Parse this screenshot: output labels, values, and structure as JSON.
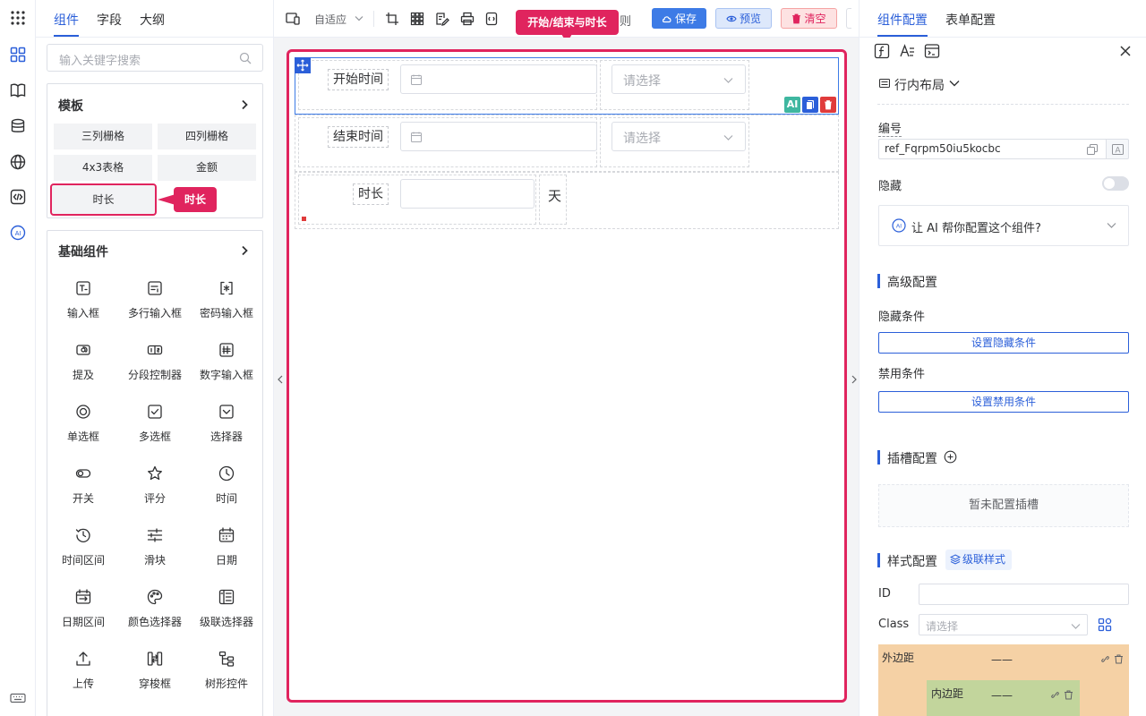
{
  "left_rail": {
    "icons": [
      "apps-grid-icon",
      "widgets-icon",
      "book-icon",
      "database-icon",
      "globe-icon",
      "code-icon",
      "ai-icon",
      "keyboard-icon"
    ]
  },
  "left_panel": {
    "tabs": [
      {
        "label": "组件",
        "active": true
      },
      {
        "label": "字段",
        "active": false
      },
      {
        "label": "大纲",
        "active": false
      }
    ],
    "search_placeholder": "输入关键字搜索",
    "templates": {
      "title": "模板",
      "items": [
        "三列栅格",
        "四列栅格",
        "4x3表格",
        "金额",
        "时长"
      ],
      "highlighted": "时长"
    },
    "basic": {
      "title": "基础组件",
      "items": [
        {
          "label": "输入框",
          "icon": "text-input-icon"
        },
        {
          "label": "多行输入框",
          "icon": "textarea-icon"
        },
        {
          "label": "密码输入框",
          "icon": "password-icon"
        },
        {
          "label": "提及",
          "icon": "mention-icon"
        },
        {
          "label": "分段控制器",
          "icon": "segmented-icon"
        },
        {
          "label": "数字输入框",
          "icon": "number-input-icon"
        },
        {
          "label": "单选框",
          "icon": "radio-icon"
        },
        {
          "label": "多选框",
          "icon": "checkbox-icon"
        },
        {
          "label": "选择器",
          "icon": "select-icon"
        },
        {
          "label": "开关",
          "icon": "switch-icon"
        },
        {
          "label": "评分",
          "icon": "star-icon"
        },
        {
          "label": "时间",
          "icon": "clock-icon"
        },
        {
          "label": "时间区间",
          "icon": "time-range-icon"
        },
        {
          "label": "滑块",
          "icon": "slider-icon"
        },
        {
          "label": "日期",
          "icon": "calendar-icon"
        },
        {
          "label": "日期区间",
          "icon": "date-range-icon"
        },
        {
          "label": "颜色选择器",
          "icon": "palette-icon"
        },
        {
          "label": "级联选择器",
          "icon": "cascader-icon"
        },
        {
          "label": "上传",
          "icon": "upload-icon"
        },
        {
          "label": "穿梭框",
          "icon": "transfer-icon"
        },
        {
          "label": "树形控件",
          "icon": "tree-icon"
        }
      ]
    }
  },
  "tooltips": {
    "duration": "时长",
    "canvas": "开始/结束与时长"
  },
  "toolbar": {
    "layout_mode": "自适应",
    "partial_text": "则",
    "save": "保存",
    "preview": "预览",
    "clear": "清空"
  },
  "canvas": {
    "rows": [
      {
        "label": "开始时间",
        "select_placeholder": "请选择"
      },
      {
        "label": "结束时间",
        "select_placeholder": "请选择"
      },
      {
        "label": "时长",
        "suffix": "天"
      }
    ]
  },
  "right_panel": {
    "tabs": [
      {
        "label": "组件配置",
        "active": true
      },
      {
        "label": "表单配置",
        "active": false
      }
    ],
    "component_type": "行内布局",
    "id_label": "编号",
    "id_value": "ref_Fqrpm50iu5kocbc",
    "hidden_label": "隐藏",
    "hidden_on": false,
    "ai_prompt": "让 AI 帮你配置这个组件?",
    "advanced_title": "高级配置",
    "hide_cond_label": "隐藏条件",
    "hide_cond_btn": "设置隐藏条件",
    "disable_cond_label": "禁用条件",
    "disable_cond_btn": "设置禁用条件",
    "slot_title": "插槽配置",
    "slot_empty": "暂未配置插槽",
    "style_title": "样式配置",
    "cascade_style": "级联样式",
    "id_field_label": "ID",
    "class_label": "Class",
    "class_placeholder": "请选择",
    "margin_label": "外边距",
    "padding_label": "内边距",
    "margin_value": "——",
    "padding_value": "——"
  },
  "colors": {
    "accent": "#2b5fd9",
    "highlight": "#e0245e",
    "danger": "#e0245e"
  }
}
